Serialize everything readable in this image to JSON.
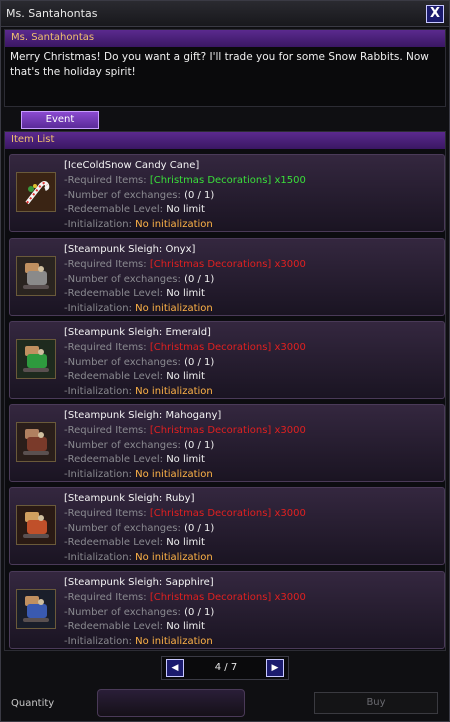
{
  "window": {
    "title": "Ms. Santahontas",
    "close_glyph": "X"
  },
  "npc": {
    "name": "Ms. Santahontas",
    "dialog": "Merry Christmas! Do you want a gift? I'll trade you for some Snow Rabbits. Now that's the holiday spirit!"
  },
  "tabs": [
    {
      "label": "Event",
      "active": true
    }
  ],
  "list": {
    "header": "Item List",
    "labels": {
      "required": "-Required Items:",
      "exchanges": "-Number of exchanges:",
      "level": "-Redeemable Level:",
      "init": "-Initialization:"
    },
    "items": [
      {
        "name": "[IceColdSnow Candy Cane]",
        "required": "[Christmas Decorations] x1500",
        "required_color": "green",
        "exchanges": "(0 / 1)",
        "level": "No limit",
        "init": "No initialization",
        "icon": "candy-cane-icon"
      },
      {
        "name": "[Steampunk Sleigh: Onyx]",
        "required": "[Christmas Decorations] x3000",
        "required_color": "red",
        "exchanges": "(0 / 1)",
        "level": "No limit",
        "init": "No initialization",
        "icon": "sleigh-onyx-icon"
      },
      {
        "name": "[Steampunk Sleigh: Emerald]",
        "required": "[Christmas Decorations] x3000",
        "required_color": "red",
        "exchanges": "(0 / 1)",
        "level": "No limit",
        "init": "No initialization",
        "icon": "sleigh-emerald-icon"
      },
      {
        "name": "[Steampunk Sleigh: Mahogany]",
        "required": "[Christmas Decorations] x3000",
        "required_color": "red",
        "exchanges": "(0 / 1)",
        "level": "No limit",
        "init": "No initialization",
        "icon": "sleigh-mahogany-icon"
      },
      {
        "name": "[Steampunk Sleigh: Ruby]",
        "required": "[Christmas Decorations] x3000",
        "required_color": "red",
        "exchanges": "(0 / 1)",
        "level": "No limit",
        "init": "No initialization",
        "icon": "sleigh-ruby-icon"
      },
      {
        "name": "[Steampunk Sleigh: Sapphire]",
        "required": "[Christmas Decorations] x3000",
        "required_color": "red",
        "exchanges": "(0 / 1)",
        "level": "No limit",
        "init": "No initialization",
        "icon": "sleigh-sapphire-icon"
      }
    ]
  },
  "pager": {
    "text": "4 / 7",
    "prev_icon": "arrow-left-icon",
    "next_icon": "arrow-right-icon"
  },
  "footer": {
    "quantity_label": "Quantity",
    "buy_label": "Buy"
  },
  "colors": {
    "accent": "#5b2a8e",
    "header_text": "#f0c070",
    "value_orange": "#ffb347",
    "required_ok": "#3adf3a",
    "required_missing": "#e02020"
  }
}
